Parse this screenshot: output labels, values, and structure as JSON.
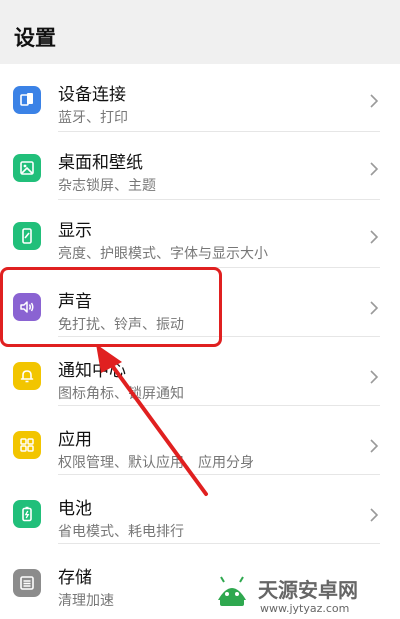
{
  "header": {
    "title": "设置"
  },
  "items": [
    {
      "title": "设备连接",
      "subtitle": "蓝牙、打印",
      "icon": "device-connect-icon",
      "color": "#3b82e6"
    },
    {
      "title": "桌面和壁纸",
      "subtitle": "杂志锁屏、主题",
      "icon": "wallpaper-icon",
      "color": "#21bf7a"
    },
    {
      "title": "显示",
      "subtitle": "亮度、护眼模式、字体与显示大小",
      "icon": "display-icon",
      "color": "#21bf7a"
    },
    {
      "title": "声音",
      "subtitle": "免打扰、铃声、振动",
      "icon": "sound-icon",
      "color": "#8a63d2"
    },
    {
      "title": "通知中心",
      "subtitle": "图标角标、锁屏通知",
      "icon": "notification-icon",
      "color": "#f2c500"
    },
    {
      "title": "应用",
      "subtitle": "权限管理、默认应用、应用分身",
      "icon": "apps-icon",
      "color": "#f2c500"
    },
    {
      "title": "电池",
      "subtitle": "省电模式、耗电排行",
      "icon": "battery-icon",
      "color": "#21bf7a"
    },
    {
      "title": "存储",
      "subtitle": "清理加速",
      "icon": "storage-icon",
      "color": "#8c8c8c"
    }
  ],
  "watermark": {
    "name": "天源安卓网",
    "url": "www.jytyaz.com"
  },
  "colors": {
    "annotation": "#e02020"
  }
}
